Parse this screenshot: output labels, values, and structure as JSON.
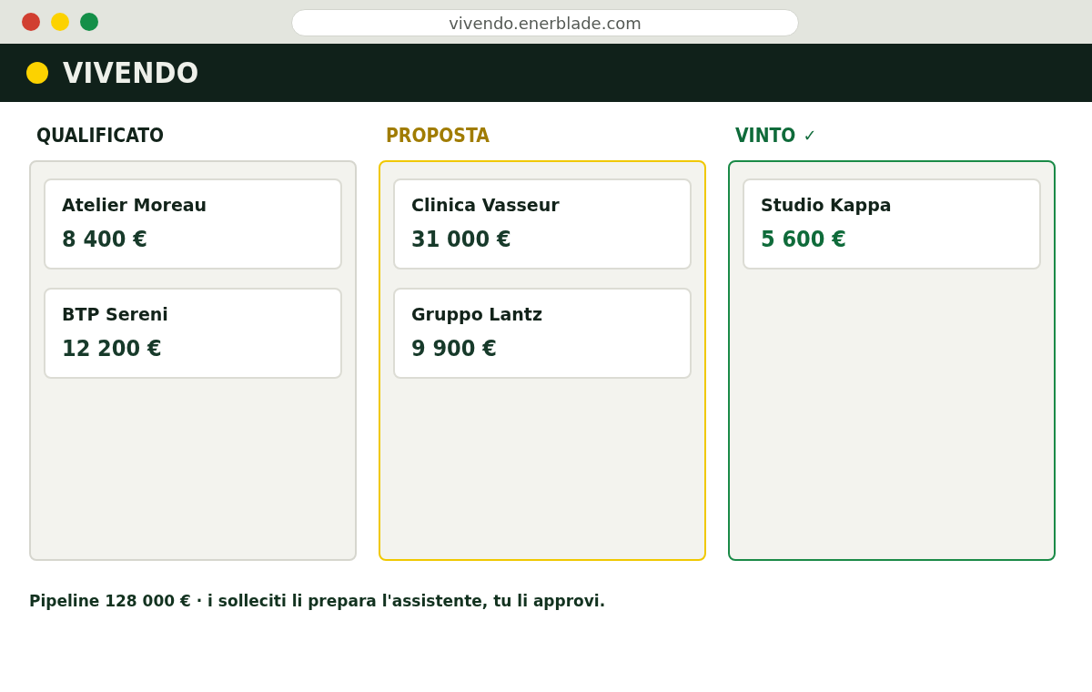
{
  "browser": {
    "window_controls": [
      {
        "color": "#d13f31"
      },
      {
        "color": "#fcd200"
      },
      {
        "color": "#148f48"
      }
    ],
    "url": "vivendo.enerblade.com"
  },
  "app": {
    "name": "VIVENDO"
  },
  "board": {
    "columns": [
      {
        "title": "QUALIFICATO",
        "kind": "open",
        "cards": [
          {
            "name": "Atelier Moreau",
            "amount": "8 400 €"
          },
          {
            "name": "BTP Sereni",
            "amount": "12 200 €"
          }
        ]
      },
      {
        "title": "PROPOSTA",
        "kind": "proposal",
        "cards": [
          {
            "name": "Clinica Vasseur",
            "amount": "31 000 €"
          },
          {
            "name": "Gruppo Lantz",
            "amount": "9 900 €"
          }
        ]
      },
      {
        "title": "VINTO",
        "mark": "✓",
        "kind": "won",
        "cards": [
          {
            "name": "Studio Kappa",
            "amount": "5 600 €"
          }
        ]
      }
    ]
  },
  "footer": "Pipeline 128 000 € · i solleciti li prepara l'assistente, tu li approvi."
}
